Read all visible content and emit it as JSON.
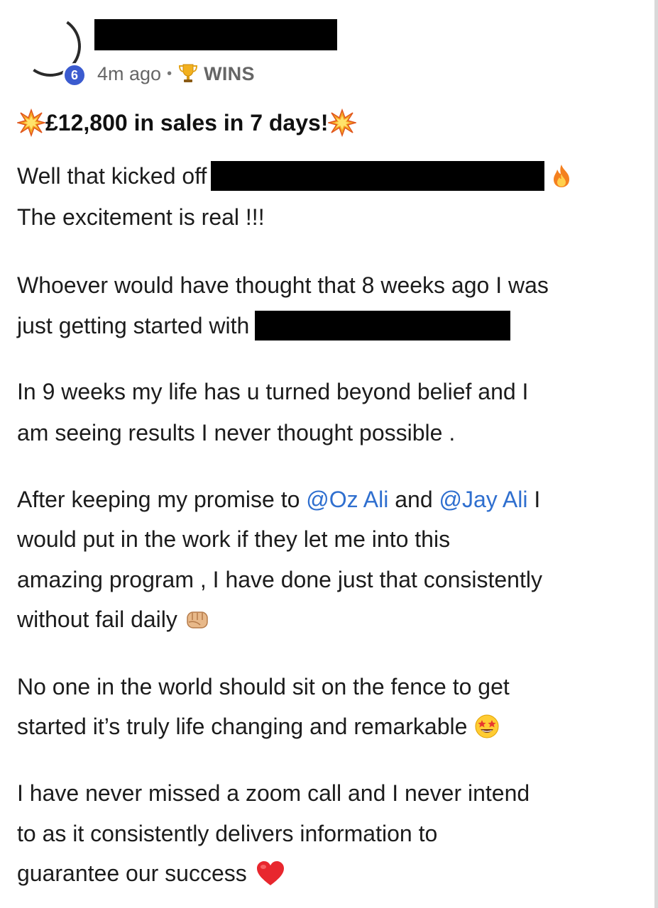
{
  "post": {
    "author": {
      "level": "6"
    },
    "meta": {
      "time_ago": "4m ago",
      "separator": "•",
      "category": "WINS"
    },
    "title": "£12,800 in sales in 7 days!",
    "body": {
      "p1_l1_text": "Well that kicked off",
      "p1_l2_text": "The excitement is real !!!",
      "p2_l1_text": "Whoever would have thought that 8 weeks ago I was",
      "p2_l2_text": "just getting started with",
      "p3_l1_text": "In 9 weeks my life has u turned beyond belief and I",
      "p3_l2_text": "am seeing results I never thought possible .",
      "p4_l1_prefix": "After keeping my promise to",
      "p4_l1_mention1": "@Oz Ali",
      "p4_l1_and": "and",
      "p4_l1_mention2": "@Jay Ali",
      "p4_l1_suffix": "I",
      "p4_l2_text": "would put in the work if they let me into this",
      "p4_l3_text": "amazing program , I have done just that consistently",
      "p4_l4_text": "without fail daily",
      "p5_l1_text": "No one in the world should sit on the fence to get",
      "p5_l2_text": "started it’s truly life changing and remarkable",
      "p6_l1_text": "I have never missed a zoom call and I never intend",
      "p6_l2_text": "to as it consistently delivers information to",
      "p6_l3_text": "guarantee our success"
    },
    "icons": {
      "trophy": "trophy-icon",
      "title_burst": "collision-emoji",
      "fire": "fire-emoji",
      "fist": "oncoming-fist-emoji",
      "star_eyes": "star-struck-emoji",
      "heart": "red-heart-emoji"
    },
    "colors": {
      "mention": "#2f6fcf",
      "badge": "#3b5bcf",
      "redaction": "#000000"
    }
  }
}
